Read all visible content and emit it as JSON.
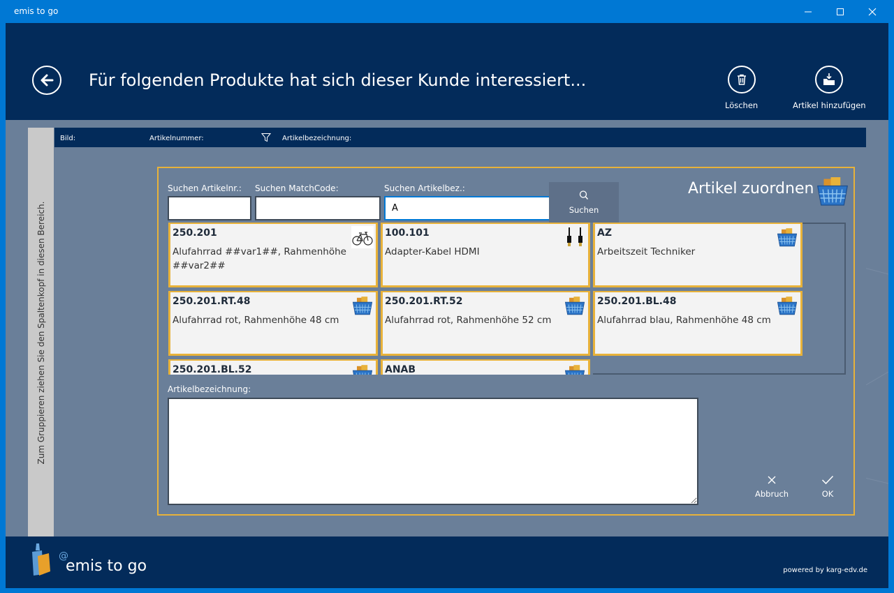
{
  "window": {
    "title": "emis to go"
  },
  "header": {
    "title": "Für folgenden Produkte hat sich dieser Kunde interessiert...",
    "delete_label": "Löschen",
    "add_label": "Artikel hinzufügen"
  },
  "grid": {
    "group_hint": "Zum Gruppieren ziehen Sie den Spaltenkopf in diesen Bereich.",
    "columns": [
      "Bild:",
      "Artikelnummer:",
      "Artikelbezeichnung:"
    ]
  },
  "dialog": {
    "title": "Artikel zuordnen",
    "search_nr_label": "Suchen Artikelnr.:",
    "search_nr_value": "",
    "search_match_label": "Suchen MatchCode:",
    "search_match_value": "",
    "search_bez_label": "Suchen Artikelbez.:",
    "search_bez_value": "A",
    "search_button": "Suchen",
    "desc_label": "Artikelbezeichnung:",
    "desc_value": "",
    "cancel_label": "Abbruch",
    "ok_label": "OK",
    "tiles": [
      {
        "code": "250.201",
        "desc": "Alufahrrad ##var1##, Rahmenhöhe ##var2##",
        "icon": "bicycle-icon"
      },
      {
        "code": "100.101",
        "desc": "Adapter-Kabel HDMI",
        "icon": "hdmi-cable-icon"
      },
      {
        "code": "AZ",
        "desc": "Arbeitszeit Techniker",
        "icon": "basket-icon"
      },
      {
        "code": "250.201.RT.48",
        "desc": "Alufahrrad rot, Rahmenhöhe 48 cm",
        "icon": "basket-icon"
      },
      {
        "code": "250.201.RT.52",
        "desc": "Alufahrrad rot, Rahmenhöhe 52 cm",
        "icon": "basket-icon"
      },
      {
        "code": "250.201.BL.48",
        "desc": "Alufahrrad blau, Rahmenhöhe 48 cm",
        "icon": "basket-icon"
      },
      {
        "code": "250.201.BL.52",
        "desc": "",
        "icon": "basket-icon"
      },
      {
        "code": "ANAB",
        "desc": "",
        "icon": "basket-icon"
      }
    ]
  },
  "footer": {
    "brand": "emis to go",
    "powered": "powered by karg-edv.de"
  }
}
